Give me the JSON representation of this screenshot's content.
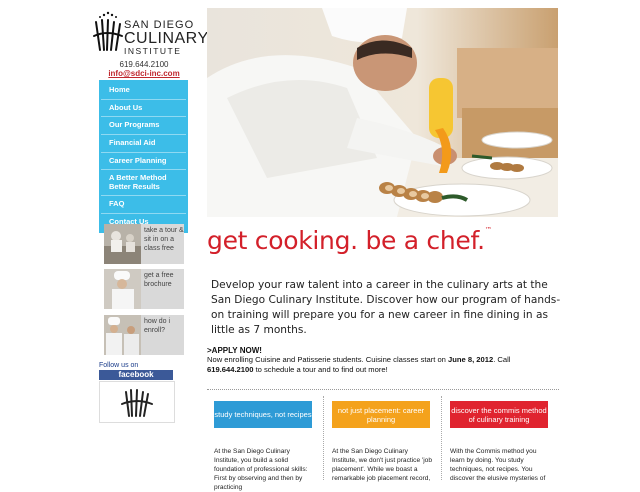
{
  "logo": {
    "line1": "SAN DIEGO",
    "line2": "CULINARY",
    "line3": "INSTITUTE"
  },
  "contact": {
    "phone": "619.644.2100",
    "email": "info@sdci-inc.com"
  },
  "nav": [
    {
      "label": "Home"
    },
    {
      "label": "About Us"
    },
    {
      "label": "Our Programs"
    },
    {
      "label": "Financial Aid"
    },
    {
      "label": "Career Planning"
    },
    {
      "label": "A Better Method Better Results"
    },
    {
      "label": "FAQ"
    },
    {
      "label": "Contact Us"
    }
  ],
  "promos": [
    {
      "label": "take a tour & sit in on a class free"
    },
    {
      "label": "get a free brochure"
    },
    {
      "label": "how do i enroll?"
    }
  ],
  "social": {
    "follow_label": "Follow us on",
    "facebook_label": "facebook"
  },
  "hero": {
    "tagline": "get cooking. be a chef.",
    "trademark": "™"
  },
  "intro": "Develop your raw talent into a career in the culinary arts at the San Diego Culinary Institute. Discover how our program of hands-on training will prepare you for a new career in fine dining in as little as 7 months.",
  "apply": {
    "heading": ">APPLY NOW!",
    "text_before": "Now enrolling Cuisine and Patisserie students. Cuisine classes start on ",
    "date": "June 8, 2012",
    "text_mid": ". Call ",
    "phone": "619.644.2100",
    "text_after": " to schedule a tour and to find out more!"
  },
  "features": [
    {
      "button": "study techniques, not recipes",
      "color": "#2e9bd6",
      "text": "At the San Diego Culinary Institute, you build a solid foundation of professional skills: First by observing and then by practicing"
    },
    {
      "button": "not just placement: career planning",
      "color": "#f4a21c",
      "text": "At the San Diego Culinary Institute, we don't just practice 'job placement'. While we boast a remarkable job placement record,"
    },
    {
      "button": "discover the commis method of culinary training",
      "color": "#e0242f",
      "text": "With the Commis method you learn by doing. You study techniques, not recipes. You discover the elusive mysteries of"
    }
  ],
  "colors": {
    "nav": "#3cbde8",
    "accent_red": "#d3202a",
    "facebook": "#3b5998"
  }
}
